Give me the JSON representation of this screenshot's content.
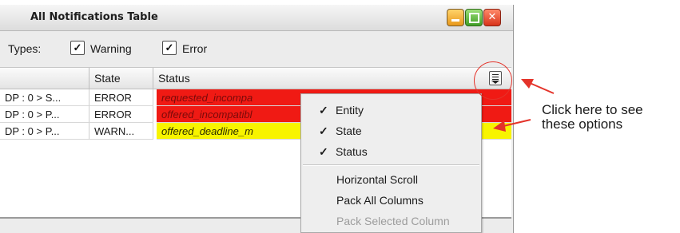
{
  "window": {
    "title": "All Notifications Table"
  },
  "filters": {
    "types_label": "Types:",
    "warning": {
      "label": "Warning",
      "checked": true
    },
    "error": {
      "label": "Error",
      "checked": true
    }
  },
  "table": {
    "columns": [
      "",
      "State",
      "Status"
    ],
    "rows": [
      {
        "entity": "DP : 0 > S...",
        "state": "ERROR",
        "status": "requested_incompa",
        "status_color": "#f01a14"
      },
      {
        "entity": "DP : 0 > P...",
        "state": "ERROR",
        "status": "offered_incompatibl",
        "status_color": "#f01a14"
      },
      {
        "entity": "DP : 0 > P...",
        "state": "WARN...",
        "status": "offered_deadline_m",
        "status_color": "#f8f400"
      }
    ]
  },
  "column_menu": {
    "check_items": [
      {
        "label": "Entity",
        "checked": true
      },
      {
        "label": "State",
        "checked": true
      },
      {
        "label": "Status",
        "checked": true
      }
    ],
    "actions": [
      {
        "label": "Horizontal Scroll",
        "enabled": true
      },
      {
        "label": "Pack All Columns",
        "enabled": true
      },
      {
        "label": "Pack Selected Column",
        "enabled": false
      }
    ]
  },
  "annotation": {
    "line1": "Click here to see",
    "line2": "these options",
    "color": "#e4332a"
  },
  "icons": {
    "check": "✓",
    "column_control": "column-control-icon"
  }
}
